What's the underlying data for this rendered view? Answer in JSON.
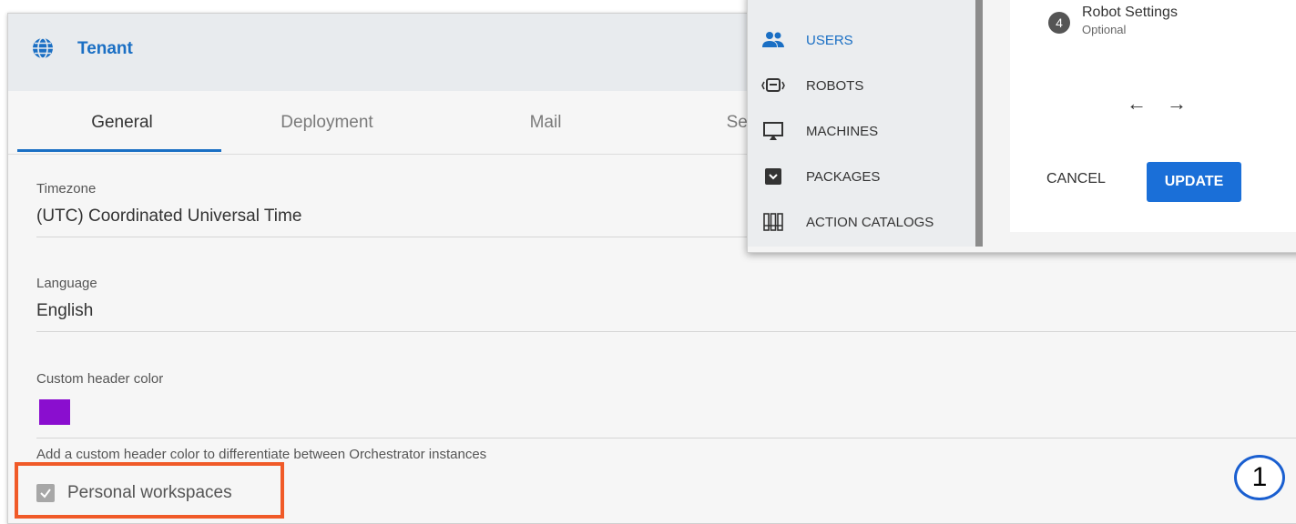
{
  "tenant": {
    "title": "Tenant",
    "tabs": [
      {
        "label": "General"
      },
      {
        "label": "Deployment"
      },
      {
        "label": "Mail"
      },
      {
        "label": "Sec"
      }
    ],
    "fields": {
      "timezone": {
        "label": "Timezone",
        "value": "(UTC) Coordinated Universal Time"
      },
      "language": {
        "label": "Language",
        "value": "English"
      },
      "header_color": {
        "label": "Custom header color",
        "color": "#8a0ecf",
        "help": "Add a custom header color to differentiate between Orchestrator instances"
      }
    },
    "personal_workspaces": {
      "label": "Personal workspaces",
      "checked": true
    }
  },
  "menu": {
    "items": [
      {
        "label": "USERS",
        "icon": "users-icon",
        "active": true
      },
      {
        "label": "ROBOTS",
        "icon": "robot-icon",
        "active": false
      },
      {
        "label": "MACHINES",
        "icon": "machine-icon",
        "active": false
      },
      {
        "label": "PACKAGES",
        "icon": "package-icon",
        "active": false
      },
      {
        "label": "ACTION CATALOGS",
        "icon": "catalog-icon",
        "active": false
      }
    ]
  },
  "dialog": {
    "step": {
      "number": "4",
      "title": "Robot Settings",
      "subtitle": "Optional"
    },
    "back_arrow": "←",
    "next_arrow": "→",
    "cancel_label": "CANCEL",
    "update_label": "UPDATE"
  },
  "callout": {
    "number": "1"
  },
  "colors": {
    "accent": "#1a6fc4",
    "highlight": "#f05a28",
    "button": "#1a6fd8"
  }
}
